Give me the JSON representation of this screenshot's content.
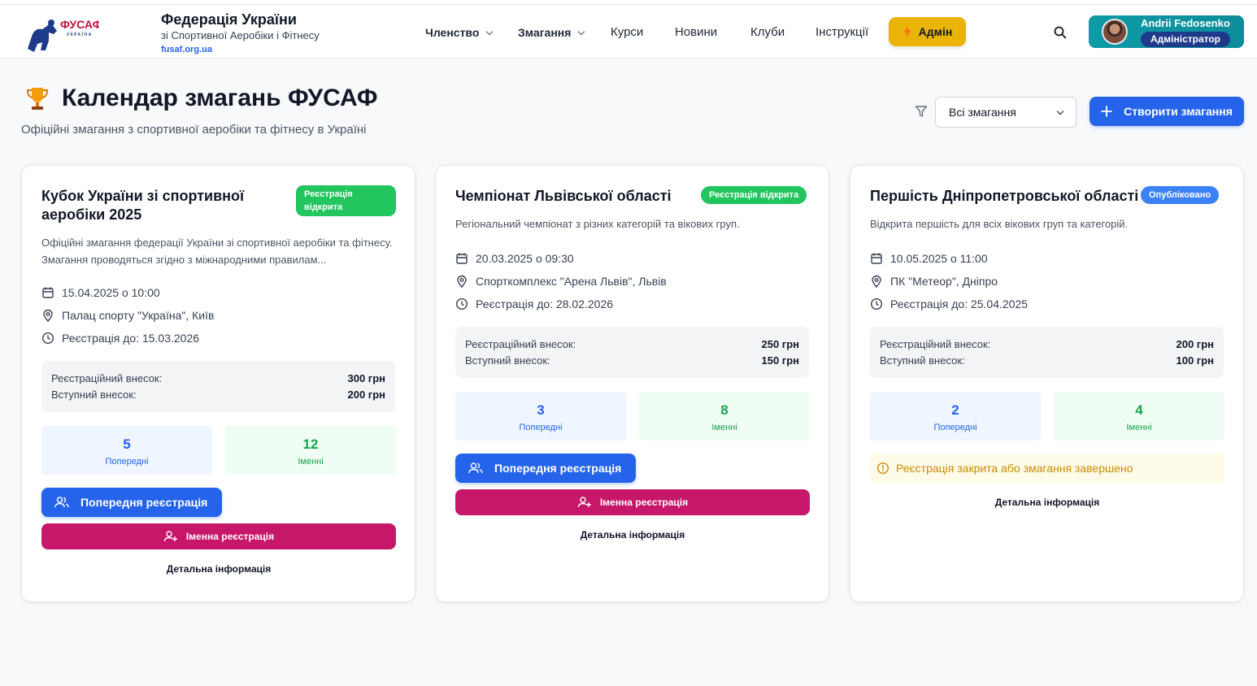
{
  "header": {
    "logo_text": "ФУСАФ",
    "logo_sub": "УКРАЇНА",
    "brand_title": "Федерація України",
    "brand_subtitle": "зі Спортивної Аеробіки і Фітнесу",
    "brand_url": "fusaf.org.ua",
    "nav": [
      {
        "label": "Членство"
      },
      {
        "label": "Змагання"
      },
      {
        "label": "Курси"
      },
      {
        "label": "Новини"
      },
      {
        "label": "Клуби"
      },
      {
        "label": "Інструкції"
      }
    ],
    "admin_label": "Адмін",
    "user_name": "Andrii Fedosenko",
    "user_role": "Адміністратор"
  },
  "page": {
    "title": "Календар змагань ФУСАФ",
    "subtitle": "Офіційні змагання з спортивної аеробіки та фітнесу в Україні",
    "filter_value": "Всі змагання",
    "create_label": "Створити змагання"
  },
  "colors": {
    "primary": "#2563eb",
    "success": "#22c55e",
    "pink": "#c7176b",
    "admin": "#eab308",
    "user_card": "#0e9aa7"
  },
  "cards": [
    {
      "title": "Кубок України зі спортивної аеробіки 2025",
      "badge": "Реєстрація відкрита",
      "description": "Офіційні змагання федерації України зі спортивної аеробіки та фітнесу. Змагання проводяться згідно з міжнародними правилам...",
      "date": "15.04.2025 о 10:00",
      "location": "Палац спорту \"Україна\", Київ",
      "deadline": "Реєстрація до: 15.03.2026",
      "fee_reg_label": "Реєстраційний внесок:",
      "fee_reg": "300 грн",
      "fee_entry_label": "Вступний внесок:",
      "fee_entry": "200 грн",
      "prelim_count": "5",
      "prelim_label": "Попередні",
      "named_count": "12",
      "named_label": "Іменні",
      "btn_prelim": "Попередня реєстрація",
      "btn_named": "Іменна реєстрація",
      "details": "Детальна інформація"
    },
    {
      "title": "Чемпіонат Львівської області",
      "badge": "Реєстрація відкрита",
      "description": "Регіональний чемпіонат з різних категорій та вікових груп.",
      "date": "20.03.2025 о 09:30",
      "location": "Спорткомплекс \"Арена Львів\", Львів",
      "deadline": "Реєстрація до: 28.02.2026",
      "fee_reg_label": "Реєстраційний внесок:",
      "fee_reg": "250 грн",
      "fee_entry_label": "Вступний внесок:",
      "fee_entry": "150 грн",
      "prelim_count": "3",
      "prelim_label": "Попередні",
      "named_count": "8",
      "named_label": "Іменні",
      "btn_prelim": "Попередня реєстрація",
      "btn_named": "Іменна реєстрація",
      "details": "Детальна інформація"
    },
    {
      "title": "Першість Дніпропетровської області",
      "badge": "Опубліковано",
      "description": "Відкрита першість для всіх вікових груп та категорій.",
      "date": "10.05.2025 о 11:00",
      "location": "ПК \"Метеор\", Дніпро",
      "deadline": "Реєстрація до: 25.04.2025",
      "fee_reg_label": "Реєстраційний внесок:",
      "fee_reg": "200 грн",
      "fee_entry_label": "Вступний внесок:",
      "fee_entry": "100 грн",
      "prelim_count": "2",
      "prelim_label": "Попередні",
      "named_count": "4",
      "named_label": "Іменні",
      "notice": "Реєстрація закрита або змагання завершено",
      "details": "Детальна інформація"
    }
  ]
}
